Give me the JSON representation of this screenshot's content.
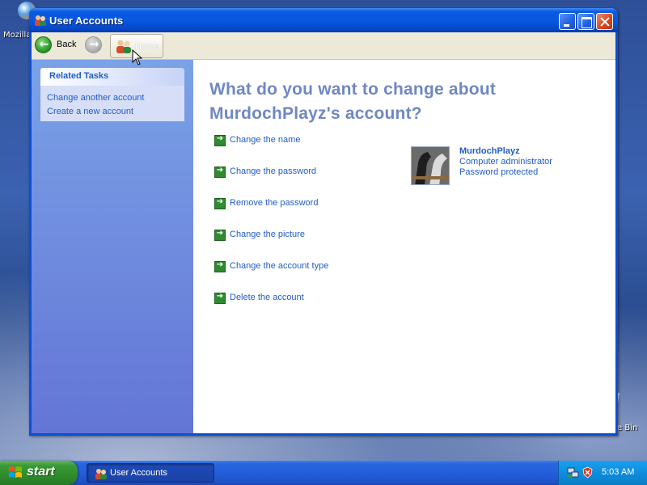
{
  "desktop": {
    "top_icon_label": "Mozilla",
    "bin_icon_label": "e Bin"
  },
  "window": {
    "title": "User Accounts"
  },
  "toolbar": {
    "back_label": "Back",
    "home_label": "Home"
  },
  "related_tasks": {
    "header": "Related Tasks",
    "links": [
      "Change another account",
      "Create a new account"
    ]
  },
  "main": {
    "heading": "What do you want to change about MurdochPlayz's account?",
    "actions": [
      "Change the name",
      "Change the password",
      "Remove the password",
      "Change the picture",
      "Change the account type",
      "Delete the account"
    ]
  },
  "user": {
    "name": "MurdochPlayz",
    "role": "Computer administrator",
    "status": "Password protected"
  },
  "taskbar": {
    "start_label": "start",
    "item_label": "User Accounts",
    "clock": "5:03 AM"
  },
  "icons": {
    "back": "back-arrow-icon",
    "forward": "forward-arrow-icon",
    "home": "users-home-icon",
    "action": "green-arrow-icon"
  },
  "colors": {
    "link": "#215dc6",
    "heading": "#6f88c2",
    "titlebar": "#0758e2",
    "start_green": "#2f8c2c"
  }
}
